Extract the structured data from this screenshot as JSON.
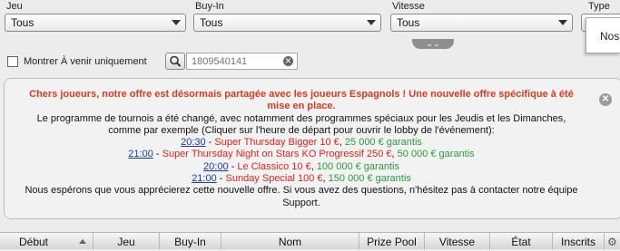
{
  "filters": {
    "jeu": {
      "label": "Jeu",
      "value": "Tous"
    },
    "buyin": {
      "label": "Buy-In",
      "value": "Tous"
    },
    "vitesse": {
      "label": "Vitesse",
      "value": "Tous"
    },
    "type": {
      "label": "Type",
      "value": ""
    }
  },
  "type_dropdown_option": "Nos",
  "expand_glyph": "⌄⌄",
  "checkbox": {
    "label": "Montrer À venir uniquement",
    "checked": false
  },
  "search": {
    "placeholder": "1809540141",
    "value": ""
  },
  "message": {
    "headline": "Chers joueurs, notre offre est désormais partagée avec les joueurs Espagnols ! Une nouvelle offre spécifique à été mise en place.",
    "body": "Le programme de tournois a été changé, avec notamment des programmes spéciaux pour les Jeudis et les Dimanches, comme par exemple (Cliquer sur l'heure de départ pour ouvrir le lobby de l'événement):",
    "promos": [
      {
        "time": "20:30",
        "name": "Super Thursday Bigger 10 €",
        "guarantee": "25 000 € garantis"
      },
      {
        "time": "21:00",
        "name": "Super Thursday Night on Stars KO Progressif 250 €",
        "guarantee": "50 000 € garantis"
      },
      {
        "time": "20:00",
        "name": "Le Classico 10 €",
        "guarantee": "100 000 € garantis"
      },
      {
        "time": "21:00",
        "name": "Sunday Special 100 €",
        "guarantee": "150 000 € garantis"
      }
    ],
    "footer": "Nous espérons que vous apprécierez cette nouvelle offre. Si vous avez des questions, n'hésitez pas à contacter notre équipe Support."
  },
  "table": {
    "columns": [
      "Début",
      "Jeu",
      "Buy-In",
      "Nom",
      "Prize Pool",
      "Vitesse",
      "État",
      "Inscrits"
    ]
  }
}
